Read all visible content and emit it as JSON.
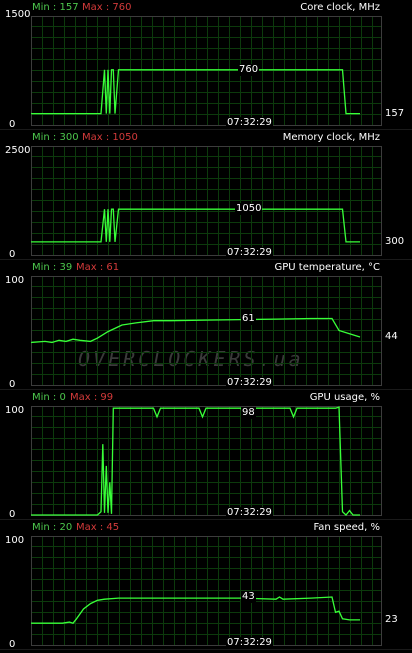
{
  "watermark": "OVERCLOCKERS.ua",
  "colors": {
    "grid": "#0c3a0c",
    "line": "#38ff38",
    "min_text": "#4cc64c",
    "max_text": "#d33a3a",
    "border": "#3c3c3c"
  },
  "graphs": [
    {
      "name": "Core clock, MHz",
      "min_label": "Min : 157",
      "max_label": "Max : 760",
      "axis_top": "1500",
      "axis_bottom": "0",
      "peak_label": "760",
      "current_label": "157",
      "time": "07:32:29",
      "chart_data": {
        "type": "line",
        "ylim": [
          0,
          1500
        ],
        "y_unit": "MHz",
        "points": [
          [
            0,
            157
          ],
          [
            20,
            157
          ],
          [
            21,
            760
          ],
          [
            21.5,
            157
          ],
          [
            22,
            760
          ],
          [
            22.5,
            157
          ],
          [
            23,
            760
          ],
          [
            23.5,
            760
          ],
          [
            24,
            157
          ],
          [
            25,
            760
          ],
          [
            89,
            760
          ],
          [
            90,
            157
          ],
          [
            94,
            157
          ]
        ]
      }
    },
    {
      "name": "Memory clock, MHz",
      "min_label": "Min : 300",
      "max_label": "Max : 1050",
      "axis_top": "2500",
      "axis_bottom": "0",
      "peak_label": "1050",
      "current_label": "300",
      "time": "07:32:29",
      "chart_data": {
        "type": "line",
        "ylim": [
          0,
          2500
        ],
        "y_unit": "MHz",
        "points": [
          [
            0,
            300
          ],
          [
            20,
            300
          ],
          [
            21,
            1050
          ],
          [
            21.5,
            300
          ],
          [
            22,
            1050
          ],
          [
            22.5,
            300
          ],
          [
            23,
            1050
          ],
          [
            23.5,
            1050
          ],
          [
            24,
            300
          ],
          [
            25,
            1050
          ],
          [
            89,
            1050
          ],
          [
            90,
            300
          ],
          [
            94,
            300
          ]
        ]
      }
    },
    {
      "name": "GPU temperature, °C",
      "min_label": "Min : 39",
      "max_label": "Max : 61",
      "axis_top": "100",
      "axis_bottom": "0",
      "peak_label": "61",
      "current_label": "44",
      "time": "07:32:29",
      "chart_data": {
        "type": "line",
        "ylim": [
          0,
          100
        ],
        "y_unit": "°C",
        "points": [
          [
            0,
            39
          ],
          [
            4,
            40
          ],
          [
            6,
            39
          ],
          [
            8,
            41
          ],
          [
            10,
            40
          ],
          [
            12,
            42
          ],
          [
            14,
            41
          ],
          [
            17,
            40
          ],
          [
            19,
            43
          ],
          [
            22,
            49
          ],
          [
            26,
            55
          ],
          [
            30,
            57
          ],
          [
            35,
            59
          ],
          [
            40,
            59
          ],
          [
            50,
            59.5
          ],
          [
            60,
            60
          ],
          [
            70,
            60.5
          ],
          [
            80,
            61
          ],
          [
            86,
            61
          ],
          [
            88,
            50
          ],
          [
            91,
            47
          ],
          [
            94,
            44
          ]
        ]
      }
    },
    {
      "name": "GPU usage, %",
      "min_label": "Min : 0",
      "max_label": "Max : 99",
      "axis_top": "100",
      "axis_bottom": "0",
      "peak_label": "98",
      "current_label": "",
      "time": "07:32:29",
      "chart_data": {
        "type": "line",
        "ylim": [
          0,
          100
        ],
        "y_unit": "%",
        "points": [
          [
            0,
            0
          ],
          [
            19,
            0
          ],
          [
            20,
            3
          ],
          [
            20.5,
            65
          ],
          [
            21,
            2
          ],
          [
            21.5,
            45
          ],
          [
            22,
            2
          ],
          [
            22.5,
            30
          ],
          [
            23,
            1
          ],
          [
            23.5,
            98
          ],
          [
            35,
            98
          ],
          [
            36,
            90
          ],
          [
            37,
            98
          ],
          [
            48,
            98
          ],
          [
            49,
            90
          ],
          [
            50,
            98
          ],
          [
            60,
            98
          ],
          [
            61,
            90
          ],
          [
            62,
            98
          ],
          [
            74,
            98
          ],
          [
            75,
            90
          ],
          [
            76,
            98
          ],
          [
            87,
            98
          ],
          [
            88,
            99
          ],
          [
            89,
            3
          ],
          [
            90,
            0
          ],
          [
            91,
            4
          ],
          [
            92,
            0
          ],
          [
            94,
            0
          ]
        ]
      }
    },
    {
      "name": "Fan speed, %",
      "min_label": "Min : 20",
      "max_label": "Max : 45",
      "axis_top": "100",
      "axis_bottom": "0",
      "peak_label": "43",
      "current_label": "23",
      "time": "07:32:29",
      "chart_data": {
        "type": "line",
        "ylim": [
          0,
          100
        ],
        "y_unit": "%",
        "points": [
          [
            0,
            20
          ],
          [
            9,
            20
          ],
          [
            11,
            21
          ],
          [
            12,
            20
          ],
          [
            13,
            24
          ],
          [
            15,
            33
          ],
          [
            17,
            38
          ],
          [
            19,
            41
          ],
          [
            21,
            42
          ],
          [
            25,
            43
          ],
          [
            30,
            43
          ],
          [
            60,
            43
          ],
          [
            70,
            42
          ],
          [
            71,
            44
          ],
          [
            72,
            42
          ],
          [
            80,
            43
          ],
          [
            86,
            44
          ],
          [
            87,
            30
          ],
          [
            88,
            31
          ],
          [
            89,
            24
          ],
          [
            91,
            23
          ],
          [
            94,
            23
          ]
        ]
      }
    }
  ]
}
